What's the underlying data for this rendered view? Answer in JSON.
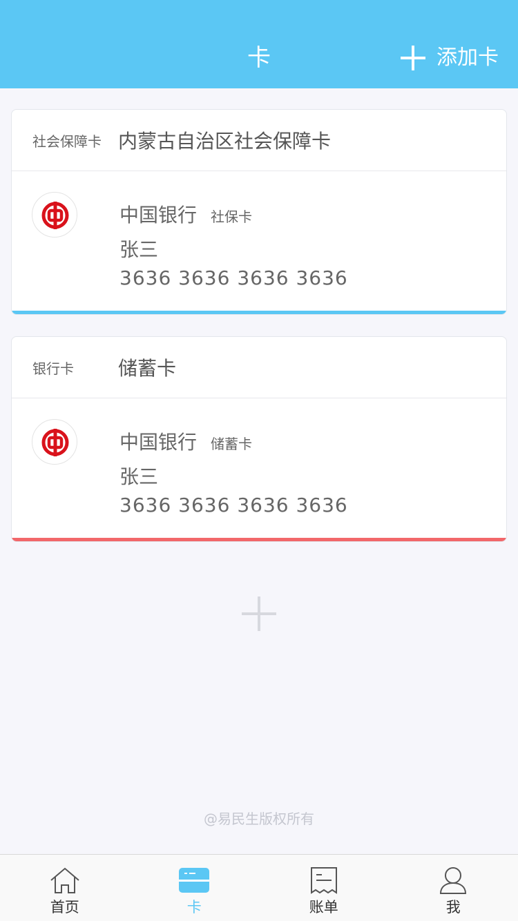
{
  "header": {
    "title": "卡",
    "add_label": "添加卡"
  },
  "cards": [
    {
      "type_label": "社会保障卡",
      "name": "内蒙古自治区社会保障卡",
      "bank_name": "中国银行",
      "sub_type": "社保卡",
      "holder": "张三",
      "number": "3636 3636 3636 3636",
      "accent_color": "#5bc7f4"
    },
    {
      "type_label": "银行卡",
      "name": "储蓄卡",
      "bank_name": "中国银行",
      "sub_type": "储蓄卡",
      "holder": "张三",
      "number": "3636 3636 3636 3636",
      "accent_color": "#f2676a"
    }
  ],
  "footer": {
    "copyright": "@易民生版权所有"
  },
  "tabbar": {
    "tabs": [
      {
        "label": "首页",
        "icon": "home-icon"
      },
      {
        "label": "卡",
        "icon": "card-icon",
        "active": true
      },
      {
        "label": "账单",
        "icon": "bill-icon"
      },
      {
        "label": "我",
        "icon": "user-icon"
      }
    ]
  },
  "colors": {
    "brand": "#5bc7f4",
    "bank_logo_red": "#d9121b"
  }
}
